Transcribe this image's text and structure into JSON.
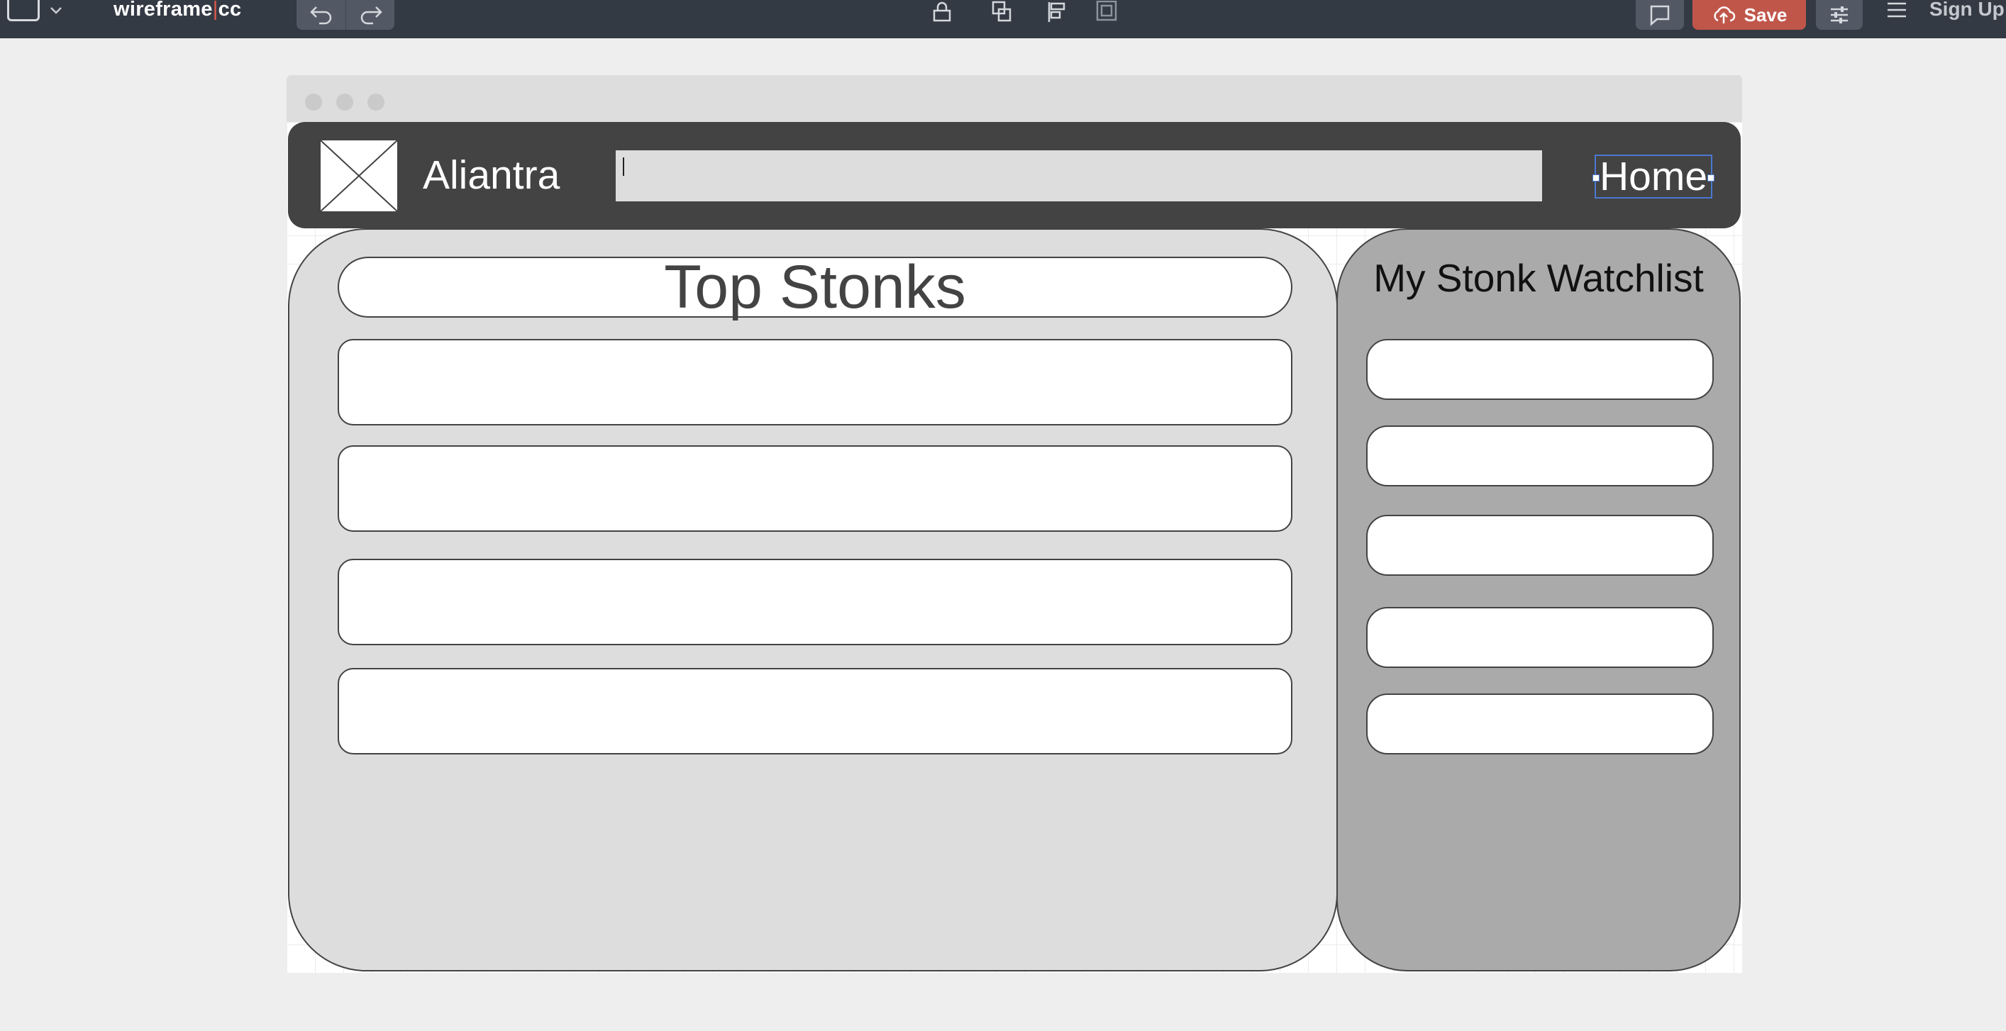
{
  "toolbar": {
    "brand_left": "wireframe",
    "brand_sep": "|",
    "brand_right": "cc",
    "save_label": "Save",
    "signup_label": "Sign Up"
  },
  "site": {
    "brand_name": "Aliantra",
    "search_value": "",
    "nav_home": "Home"
  },
  "top_stonks": {
    "title": "Top Stonks",
    "rows": [
      "",
      "",
      "",
      "",
      ""
    ]
  },
  "watchlist": {
    "title": "My Stonk Watchlist",
    "rows": [
      "",
      "",
      "",
      "",
      ""
    ]
  },
  "colors": {
    "toolbar_bg": "#343a44",
    "save_bg": "#c0564a",
    "header_bg": "#434343",
    "panel_light": "#dddddd",
    "panel_dark": "#aaaaaa",
    "selection": "#4b78d2"
  },
  "icons": [
    "shape-picker-icon",
    "chevron-down-icon",
    "undo-icon",
    "redo-icon",
    "lock-icon",
    "duplicate-icon",
    "align-icon",
    "layer-icon",
    "comment-icon",
    "cloud-upload-icon",
    "sliders-icon",
    "hamburger-menu-icon",
    "image-placeholder-icon"
  ]
}
